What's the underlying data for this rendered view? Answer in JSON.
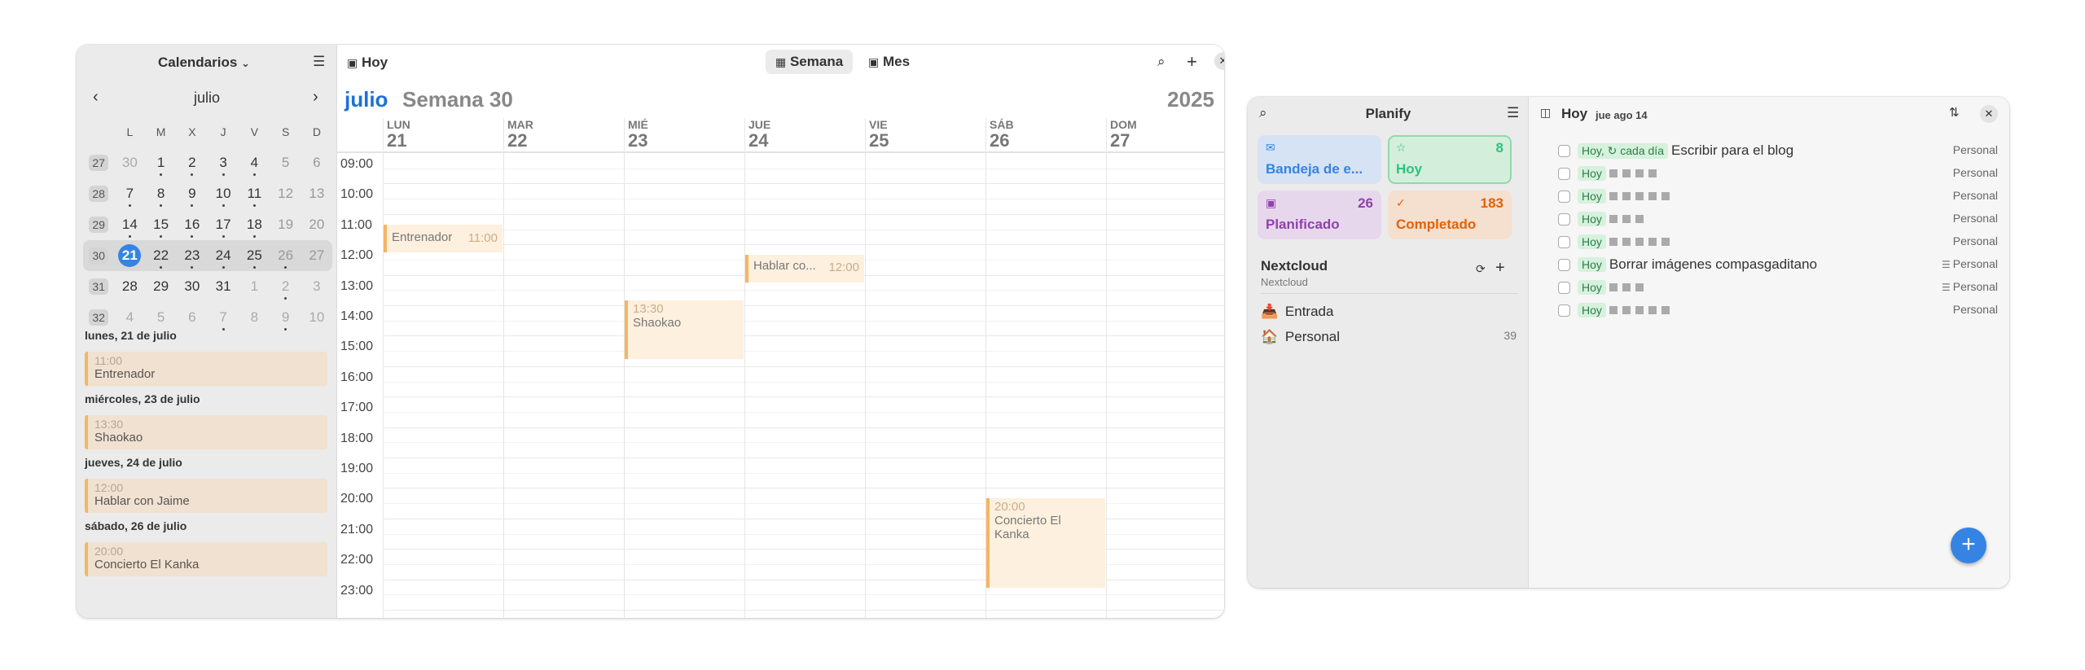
{
  "calendar": {
    "sidebar_title": "Calendarios",
    "mini": {
      "month": "julio",
      "weekday_headers": [
        "L",
        "M",
        "X",
        "J",
        "V",
        "S",
        "D"
      ],
      "weeks": [
        {
          "wk": "27",
          "days": [
            "30",
            "1",
            "2",
            "3",
            "4",
            "5",
            "6"
          ]
        },
        {
          "wk": "28",
          "days": [
            "7",
            "8",
            "9",
            "10",
            "11",
            "12",
            "13"
          ]
        },
        {
          "wk": "29",
          "days": [
            "14",
            "15",
            "16",
            "17",
            "18",
            "19",
            "20"
          ]
        },
        {
          "wk": "30",
          "days": [
            "21",
            "22",
            "23",
            "24",
            "25",
            "26",
            "27"
          ]
        },
        {
          "wk": "31",
          "days": [
            "28",
            "29",
            "30",
            "31",
            "1",
            "2",
            "3"
          ]
        },
        {
          "wk": "32",
          "days": [
            "4",
            "5",
            "6",
            "7",
            "8",
            "9",
            "10"
          ]
        }
      ]
    },
    "agenda": [
      {
        "date": "lunes, 21 de julio",
        "time": "11:00",
        "title": "Entrenador"
      },
      {
        "date": "miércoles, 23 de julio",
        "time": "13:30",
        "title": "Shaokao"
      },
      {
        "date": "jueves, 24 de julio",
        "time": "12:00",
        "title": "Hablar con Jaime"
      },
      {
        "date": "sábado, 26 de julio",
        "time": "20:00",
        "title": "Concierto El Kanka"
      }
    ],
    "toolbar": {
      "today": "Hoy",
      "week": "Semana",
      "month": "Mes"
    },
    "header": {
      "month": "julio",
      "week": "Semana 30",
      "year": "2025"
    },
    "days": [
      {
        "name": "LUN",
        "num": "21"
      },
      {
        "name": "MAR",
        "num": "22"
      },
      {
        "name": "MIÉ",
        "num": "23"
      },
      {
        "name": "JUE",
        "num": "24"
      },
      {
        "name": "VIE",
        "num": "25"
      },
      {
        "name": "SÁB",
        "num": "26"
      },
      {
        "name": "DOM",
        "num": "27"
      }
    ],
    "hours": [
      "09:00",
      "10:00",
      "11:00",
      "12:00",
      "13:00",
      "14:00",
      "15:00",
      "16:00",
      "17:00",
      "18:00",
      "19:00",
      "20:00",
      "21:00",
      "22:00",
      "23:00"
    ],
    "events": {
      "e1": {
        "title": "Entrenador",
        "time": "11:00"
      },
      "e2": {
        "title": "Hablar co...",
        "time": "12:00"
      },
      "e3": {
        "title": "Shaokao",
        "time": "13:30"
      },
      "e4": {
        "title1": "Concierto El",
        "title2": "Kanka",
        "time": "20:00"
      }
    }
  },
  "planify": {
    "title": "Planify",
    "tiles": {
      "inbox": {
        "label": "Bandeja de e...",
        "count": ""
      },
      "today": {
        "label": "Hoy",
        "count": "8"
      },
      "scheduled": {
        "label": "Planificado",
        "count": "26"
      },
      "completed": {
        "label": "Completado",
        "count": "183"
      }
    },
    "source": {
      "name": "Nextcloud",
      "sub": "Nextcloud"
    },
    "projects": [
      {
        "name": "Entrada",
        "count": ""
      },
      {
        "name": "Personal",
        "count": "39"
      }
    ],
    "main_title": "Hoy",
    "main_date": "jue ago 14",
    "tag_today": "Hoy",
    "tag_today_comma": "Hoy,",
    "tag_repeat": "cada día",
    "task1": "Escribir para el blog",
    "task6": "Borrar imágenes compasgaditano",
    "project_label": "Personal",
    "colors": {
      "accent": "#3584e4",
      "inbox": "#3584e4",
      "today": "#2ec27e",
      "scheduled": "#9141ac",
      "completed": "#e66100"
    }
  }
}
